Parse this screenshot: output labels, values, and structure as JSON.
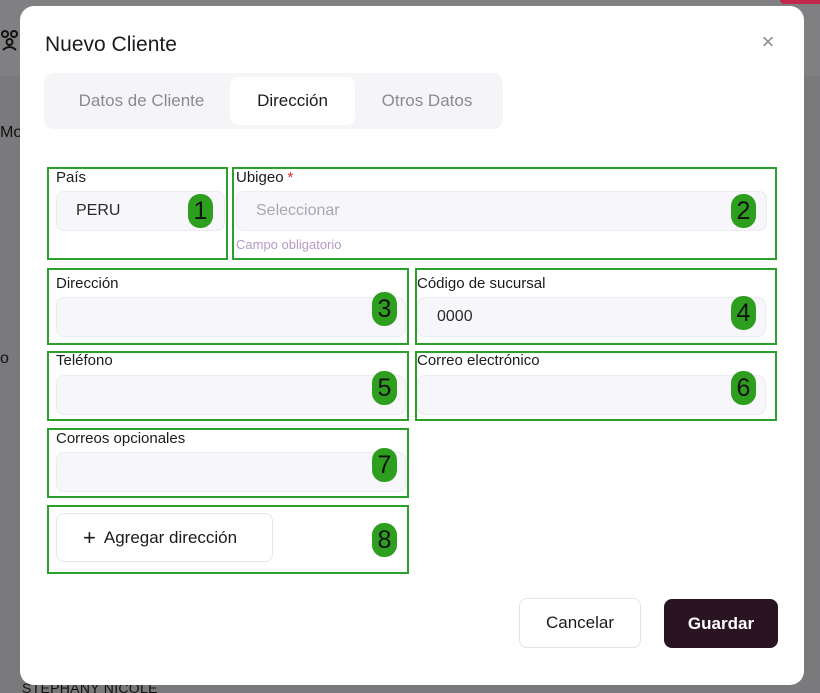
{
  "background": {
    "column_fragment": "Mo",
    "row_fragment": "o",
    "name_fragment": "STEPHANY NICOLE"
  },
  "modal": {
    "title": "Nuevo Cliente",
    "close_icon": "close-icon"
  },
  "tabs": [
    {
      "label": "Datos de Cliente",
      "active": false
    },
    {
      "label": "Dirección",
      "active": true
    },
    {
      "label": "Otros Datos",
      "active": false
    }
  ],
  "form": {
    "pais": {
      "label": "País",
      "value": "PERU"
    },
    "ubigeo": {
      "label": "Ubigeo",
      "required_mark": "*",
      "placeholder": "Seleccionar",
      "hint": "Campo obligatorio"
    },
    "direccion": {
      "label": "Dirección",
      "value": ""
    },
    "codigo_sucursal": {
      "label": "Código de sucursal",
      "value": "0000"
    },
    "telefono": {
      "label": "Teléfono",
      "value": ""
    },
    "correo": {
      "label": "Correo electrónico",
      "value": ""
    },
    "correos_opcionales": {
      "label": "Correos opcionales",
      "value": ""
    },
    "add_address": {
      "label": "Agregar dirección",
      "icon": "plus-icon"
    }
  },
  "annotations": [
    "1",
    "2",
    "3",
    "4",
    "5",
    "6",
    "7",
    "8"
  ],
  "annotation_color": "#2ca02c",
  "footer": {
    "cancel_label": "Cancelar",
    "save_label": "Guardar"
  },
  "colors": {
    "primary_button": "#2b1422",
    "required": "#d62b2b",
    "hint": "#b49ac2"
  }
}
